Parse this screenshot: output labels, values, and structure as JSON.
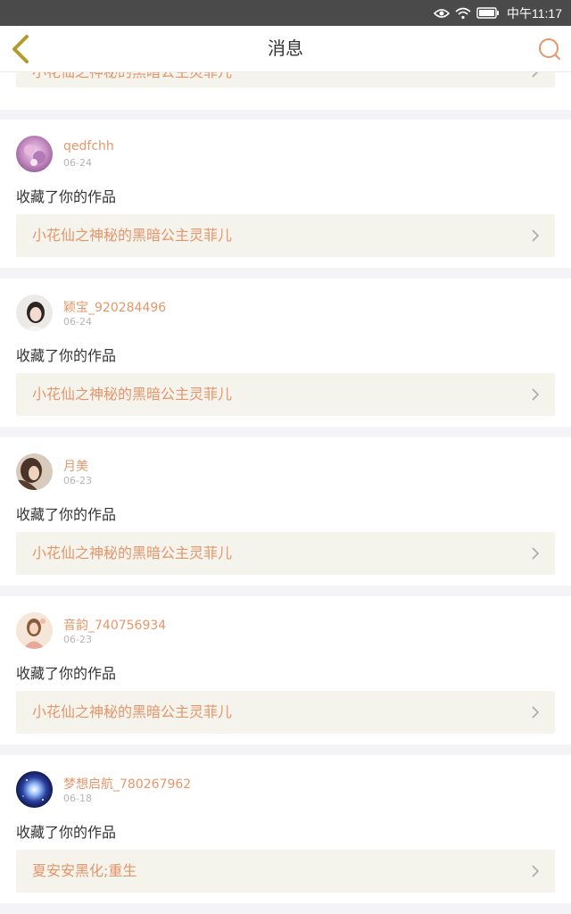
{
  "status_bar": {
    "time": "中午11:17"
  },
  "nav": {
    "title": "消息"
  },
  "colors": {
    "accent": "#e5956a",
    "back_arrow": "#b49a2a",
    "row_bg": "#f4f3ec"
  },
  "partial": {
    "work_title": "小花仙之神秘的黑暗公主灵菲儿"
  },
  "notifications": [
    {
      "username": "qedfchh",
      "date": "06-24",
      "action": "收藏了你的作品",
      "work_title": "小花仙之神秘的黑暗公主灵菲儿"
    },
    {
      "username": "颖宝_920284496",
      "date": "06-24",
      "action": "收藏了你的作品",
      "work_title": "小花仙之神秘的黑暗公主灵菲儿"
    },
    {
      "username": "月美",
      "date": "06-23",
      "action": "收藏了你的作品",
      "work_title": "小花仙之神秘的黑暗公主灵菲儿"
    },
    {
      "username": "音韵_740756934",
      "date": "06-23",
      "action": "收藏了你的作品",
      "work_title": "小花仙之神秘的黑暗公主灵菲儿"
    },
    {
      "username": "梦想启航_780267962",
      "date": "06-18",
      "action": "收藏了你的作品",
      "work_title": "夏安安黑化;重生"
    }
  ]
}
